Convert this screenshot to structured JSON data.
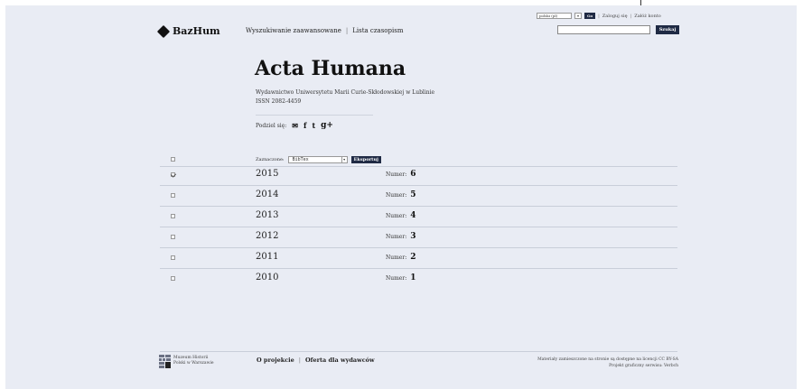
{
  "header": {
    "logo_text": "BazHum",
    "nav": [
      "Wyszukiwanie zaawansowane",
      "Lista czasopism"
    ],
    "language_selected": "polski (pl)",
    "language_go": "Go",
    "login": "Zaloguj się",
    "register": "Załóż konto",
    "search_placeholder": "",
    "search_button": "Szukaj"
  },
  "journal": {
    "title": "Acta Humana",
    "publisher": "Wydawnictwo Uniwersytetu Marii Curie-Skłodowskiej w Lublinie",
    "issn": "ISSN 2082-4459",
    "share_label": "Podziel się:",
    "share_icons": [
      "envelope-icon",
      "facebook-icon",
      "tumblr-icon",
      "google-plus-icon"
    ]
  },
  "toolbar": {
    "marked_label": "Zaznaczone:",
    "format_selected": "BibTex",
    "export_button": "Eksportuj"
  },
  "issues": [
    {
      "year": "2015",
      "numer_label": "Numer:",
      "numer": "6",
      "checked": true
    },
    {
      "year": "2014",
      "numer_label": "Numer:",
      "numer": "5",
      "checked": false
    },
    {
      "year": "2013",
      "numer_label": "Numer:",
      "numer": "4",
      "checked": false
    },
    {
      "year": "2012",
      "numer_label": "Numer:",
      "numer": "3",
      "checked": false
    },
    {
      "year": "2011",
      "numer_label": "Numer:",
      "numer": "2",
      "checked": false
    },
    {
      "year": "2010",
      "numer_label": "Numer:",
      "numer": "1",
      "checked": false
    }
  ],
  "footer": {
    "museum_line1": "Muzeum Historii",
    "museum_line2": "Polski w Warszawie",
    "nav": [
      "O projekcie",
      "Oferta dla wydawców"
    ],
    "license_line1": "Materiały zamieszczone na stronie są dostępne na licencji CC BY-SA",
    "license_line2": "Projekt graficzny serwisu: Verbch"
  },
  "colors": {
    "page_background": "#e9ecf4",
    "accent_dark": "#1f2a44"
  }
}
